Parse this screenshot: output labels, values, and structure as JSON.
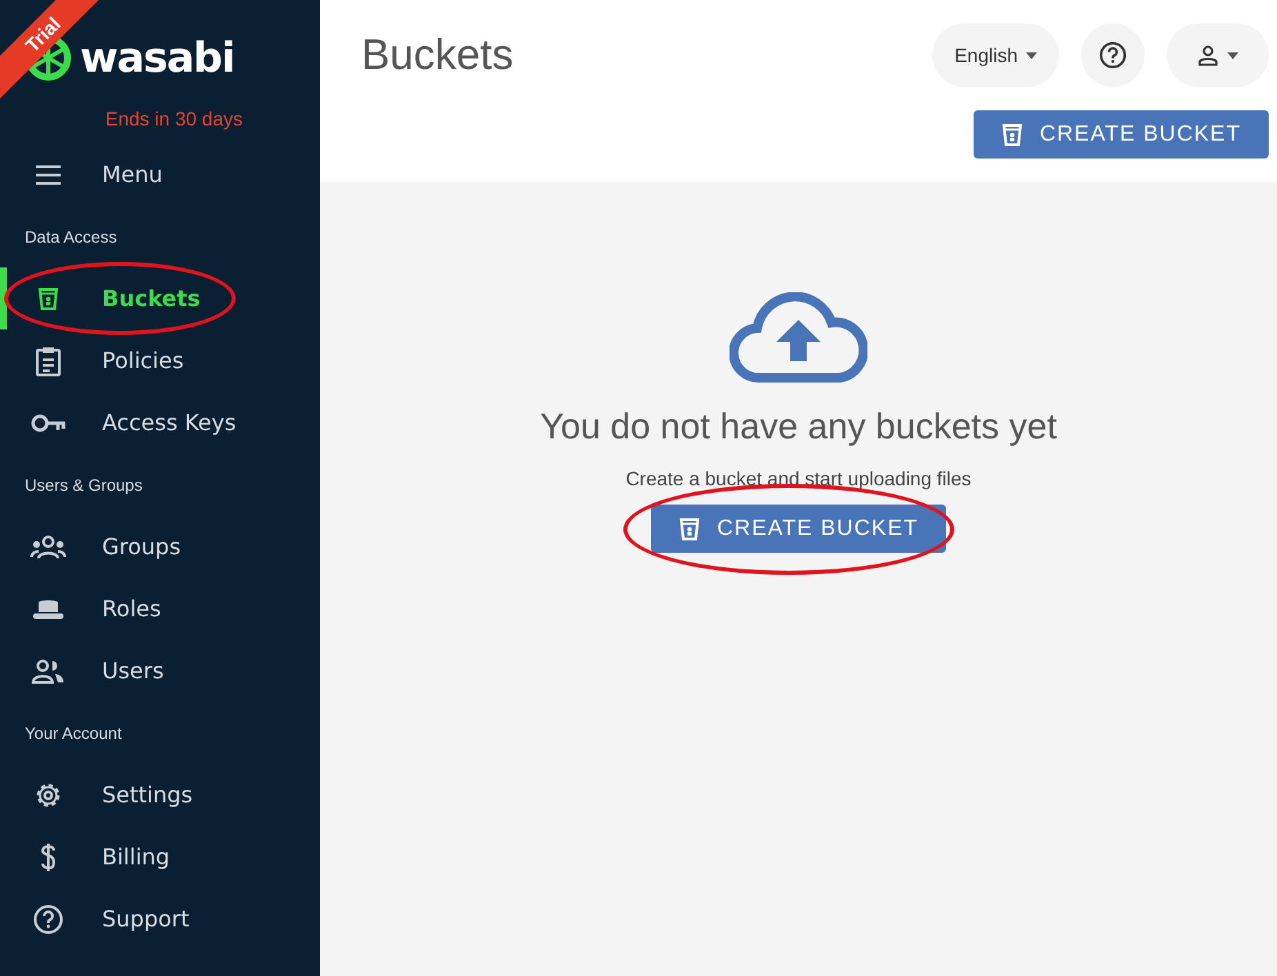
{
  "sidebar": {
    "ribbon": "Trial",
    "logo": "wasabi",
    "trial_notice": "Ends in 30 days",
    "menu_label": "Menu",
    "sections": [
      {
        "title": "Data Access",
        "items": [
          {
            "label": "Buckets",
            "selected": true,
            "annotated": true
          },
          {
            "label": "Policies",
            "selected": false,
            "annotated": false
          },
          {
            "label": "Access Keys",
            "selected": false,
            "annotated": false
          }
        ]
      },
      {
        "title": "Users & Groups",
        "items": [
          {
            "label": "Groups",
            "selected": false,
            "annotated": false
          },
          {
            "label": "Roles",
            "selected": false,
            "annotated": false
          },
          {
            "label": "Users",
            "selected": false,
            "annotated": false
          }
        ]
      },
      {
        "title": "Your Account",
        "items": [
          {
            "label": "Settings",
            "selected": false,
            "annotated": false
          },
          {
            "label": "Billing",
            "selected": false,
            "annotated": false
          },
          {
            "label": "Support",
            "selected": false,
            "annotated": false
          }
        ]
      }
    ]
  },
  "header": {
    "title": "Buckets",
    "language": "English",
    "create_button": "CREATE BUCKET"
  },
  "empty_state": {
    "heading": "You do not have any buckets yet",
    "subtext": "Create a bucket and start uploading files",
    "button": "CREATE BUCKET",
    "annotated": true
  }
}
